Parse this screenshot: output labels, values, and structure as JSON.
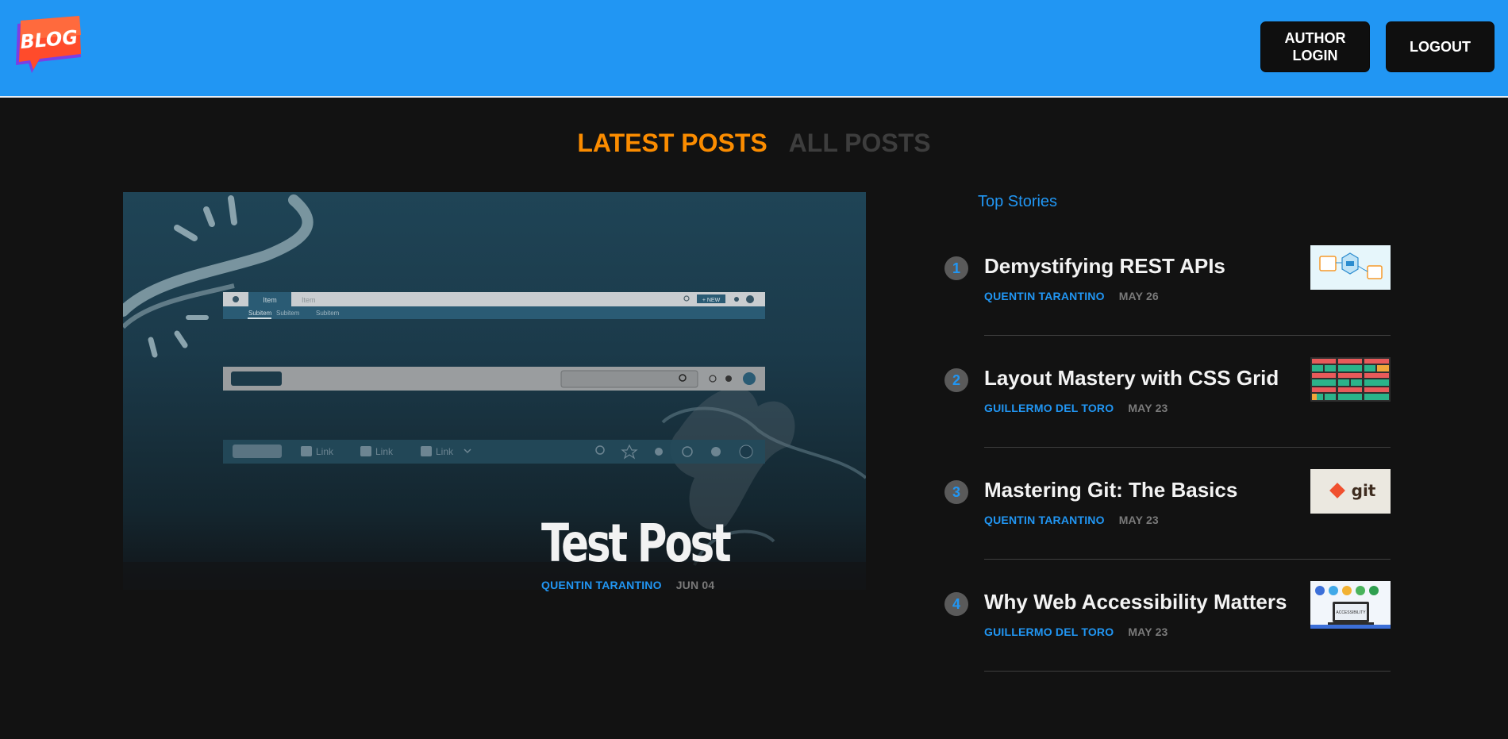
{
  "header": {
    "logo_text": "BLOG",
    "author_login_label": "AUTHOR LOGIN",
    "logout_label": "LOGOUT"
  },
  "tabs": {
    "latest_label": "LATEST POSTS",
    "all_label": "ALL POSTS"
  },
  "featured": {
    "title": "Test Post",
    "author": "QUENTIN TARANTINO",
    "date": "JUN 04",
    "image_text": {
      "item1": "Item",
      "item2": "Item",
      "new_button": "+ NEW",
      "subitems": [
        "Subitem",
        "Subitem",
        "Subitem"
      ],
      "links": [
        "Link",
        "Link",
        "Link"
      ]
    }
  },
  "top_stories": {
    "title": "Top Stories",
    "items": [
      {
        "number": "1",
        "title": "Demystifying REST APIs",
        "author": "QUENTIN TARANTINO",
        "date": "MAY 26"
      },
      {
        "number": "2",
        "title": "Layout Mastery with CSS Grid",
        "author": "GUILLERMO DEL TORO",
        "date": "MAY 23"
      },
      {
        "number": "3",
        "title": "Mastering Git: The Basics",
        "author": "QUENTIN TARANTINO",
        "date": "MAY 23",
        "thumb_text": "git"
      },
      {
        "number": "4",
        "title": "Why Web Accessibility Matters",
        "author": "GUILLERMO DEL TORO",
        "date": "MAY 23",
        "thumb_text": "ACCESSIBILITY"
      }
    ]
  },
  "colors": {
    "header_bg": "#2196f3",
    "page_bg": "#121212",
    "accent_orange": "#fb8c00",
    "accent_blue": "#2196f3"
  }
}
